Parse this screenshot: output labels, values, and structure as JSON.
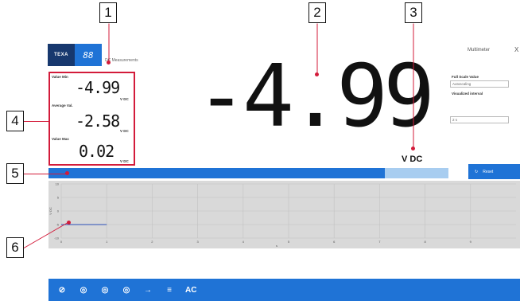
{
  "header": {
    "logo_text": "TEXA",
    "mode_display": "88",
    "mode_label": "DC Measurements",
    "app_title": "Multimeter",
    "close_glyph": "X"
  },
  "stats": {
    "min_label": "Value Min",
    "min_value": "-4.99",
    "avg_label": "Average Val.",
    "avg_value": "-2.58",
    "max_label": "Value Max",
    "max_value": "0.02",
    "unit": "V DC"
  },
  "reading": {
    "value": "-4.99",
    "unit": "V DC"
  },
  "settings": {
    "full_scale_label": "Full Scale Value",
    "full_scale_value": "Autoscaling",
    "interval_label": "Visualized interval",
    "interval_value": "2 s"
  },
  "progress": {
    "fraction": 0.84
  },
  "reset_label": "Reset",
  "chart_data": {
    "type": "line",
    "x": [
      0,
      1
    ],
    "y": [
      -4.99,
      -4.99
    ],
    "xticks": [
      "0",
      "1",
      "2",
      "3",
      "4",
      "5",
      "6",
      "7",
      "8",
      "9"
    ],
    "yticks": [
      "10",
      "5",
      "0",
      "-5",
      "-10"
    ],
    "xlim": [
      0,
      10
    ],
    "ylim": [
      -10,
      10
    ],
    "ylabel": "V DC",
    "xlabel": "s",
    "grid": true,
    "line_color": "#2b4fb8"
  },
  "toolbar": {
    "items": [
      {
        "name": "clamp-icon",
        "glyph": "⊘"
      },
      {
        "name": "probe-a-icon",
        "glyph": "◎"
      },
      {
        "name": "probe-b-icon",
        "glyph": "◎"
      },
      {
        "name": "probe-c-icon",
        "glyph": "◎"
      },
      {
        "name": "diode-icon",
        "glyph": "→"
      },
      {
        "name": "dc-icon",
        "glyph": "≡"
      }
    ],
    "ac_label": "AC"
  },
  "callouts": [
    "1",
    "2",
    "3",
    "4",
    "5",
    "6"
  ],
  "colors": {
    "accent": "#1f73d6",
    "brand": "#17386e",
    "callout": "#d31b3a"
  }
}
